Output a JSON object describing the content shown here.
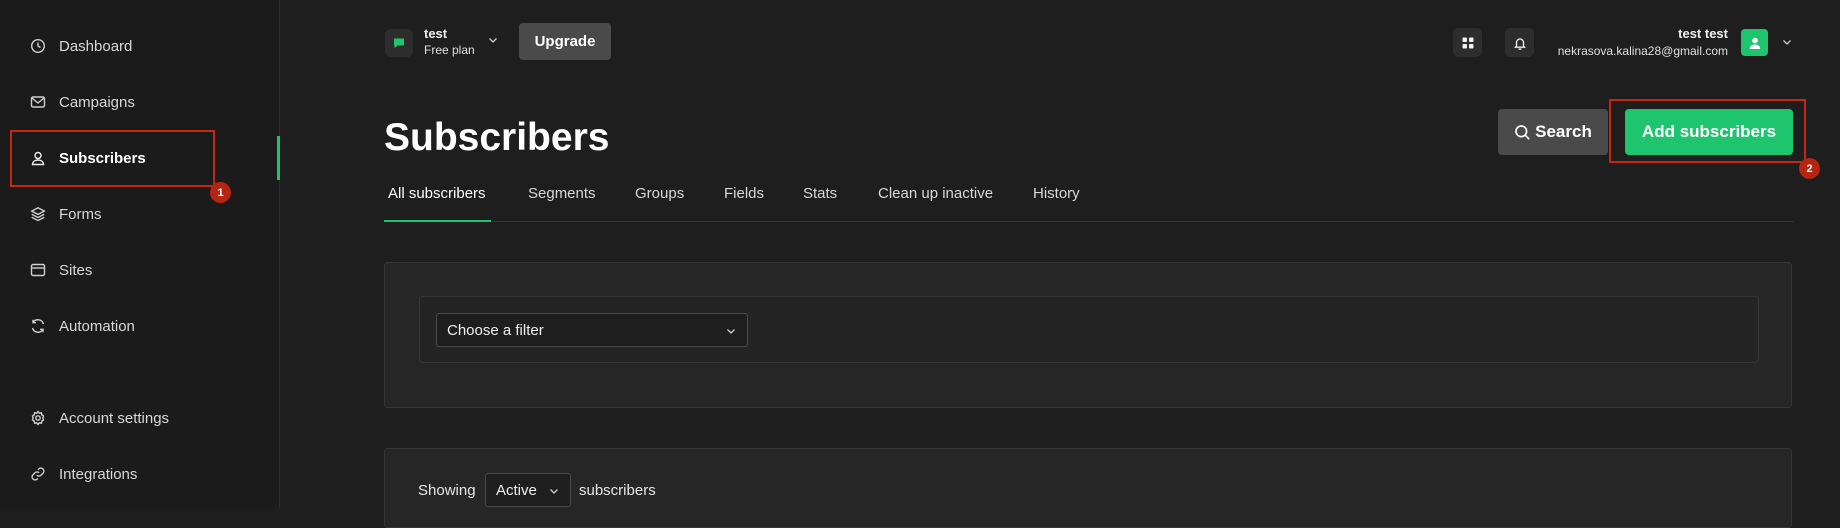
{
  "sidebar": {
    "items": [
      {
        "label": "Dashboard",
        "icon": "dashboard-icon"
      },
      {
        "label": "Campaigns",
        "icon": "mail-icon"
      },
      {
        "label": "Subscribers",
        "icon": "user-icon"
      },
      {
        "label": "Forms",
        "icon": "layers-icon"
      },
      {
        "label": "Sites",
        "icon": "browser-icon"
      },
      {
        "label": "Automation",
        "icon": "refresh-icon"
      },
      {
        "label": "Account settings",
        "icon": "gear-icon"
      },
      {
        "label": "Integrations",
        "icon": "link-icon"
      }
    ],
    "active": "Subscribers"
  },
  "annotations": {
    "badge1": "1",
    "badge2": "2"
  },
  "header": {
    "team_name": "test",
    "team_plan": "Free plan",
    "upgrade_label": "Upgrade",
    "user_name": "test test",
    "user_email": "nekrasova.kalina28@gmail.com"
  },
  "page": {
    "title": "Subscribers",
    "search_label": "Search",
    "add_label": "Add subscribers"
  },
  "tabs": [
    "All subscribers",
    "Segments",
    "Groups",
    "Fields",
    "Stats",
    "Clean up inactive",
    "History"
  ],
  "filter": {
    "value": "Choose a filter"
  },
  "showing": {
    "prefix": "Showing",
    "status": "Active",
    "suffix": "subscribers"
  },
  "colors": {
    "accent": "#1fc46e",
    "annotation": "#c5280f"
  }
}
